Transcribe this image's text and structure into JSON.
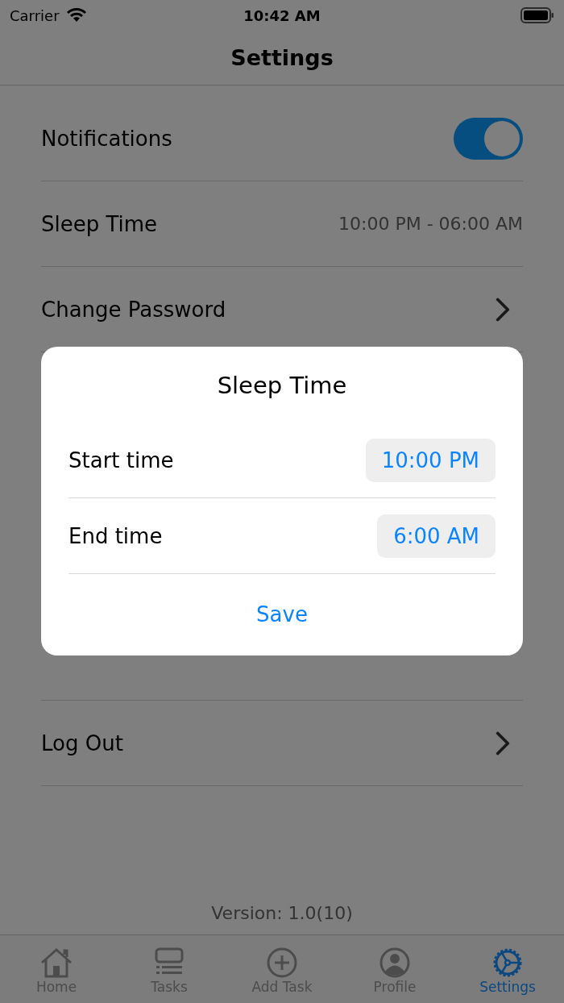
{
  "status_bar": {
    "carrier": "Carrier",
    "time": "10:42 AM"
  },
  "nav": {
    "title": "Settings"
  },
  "rows": [
    {
      "kind": "toggle",
      "label": "Notifications",
      "on": true
    },
    {
      "kind": "value",
      "label": "Sleep Time",
      "value": "10:00 PM - 06:00 AM"
    },
    {
      "kind": "link",
      "label": "Change Password"
    }
  ],
  "rows_below": [
    {
      "kind": "link",
      "label": "Log Out"
    }
  ],
  "version": "Version: 1.0(10)",
  "dialog": {
    "title": "Sleep Time",
    "fields": [
      {
        "label": "Start time",
        "value": "10:00 PM"
      },
      {
        "label": "End time",
        "value": "6:00 AM"
      }
    ],
    "button": "Save"
  },
  "tabs": [
    {
      "kind": "home",
      "label": "Home",
      "selected": false
    },
    {
      "kind": "tasks",
      "label": "Tasks",
      "selected": false
    },
    {
      "kind": "add",
      "label": "Add Task",
      "selected": false
    },
    {
      "kind": "profile",
      "label": "Profile",
      "selected": false
    },
    {
      "kind": "settings",
      "label": "Settings",
      "selected": true
    }
  ]
}
